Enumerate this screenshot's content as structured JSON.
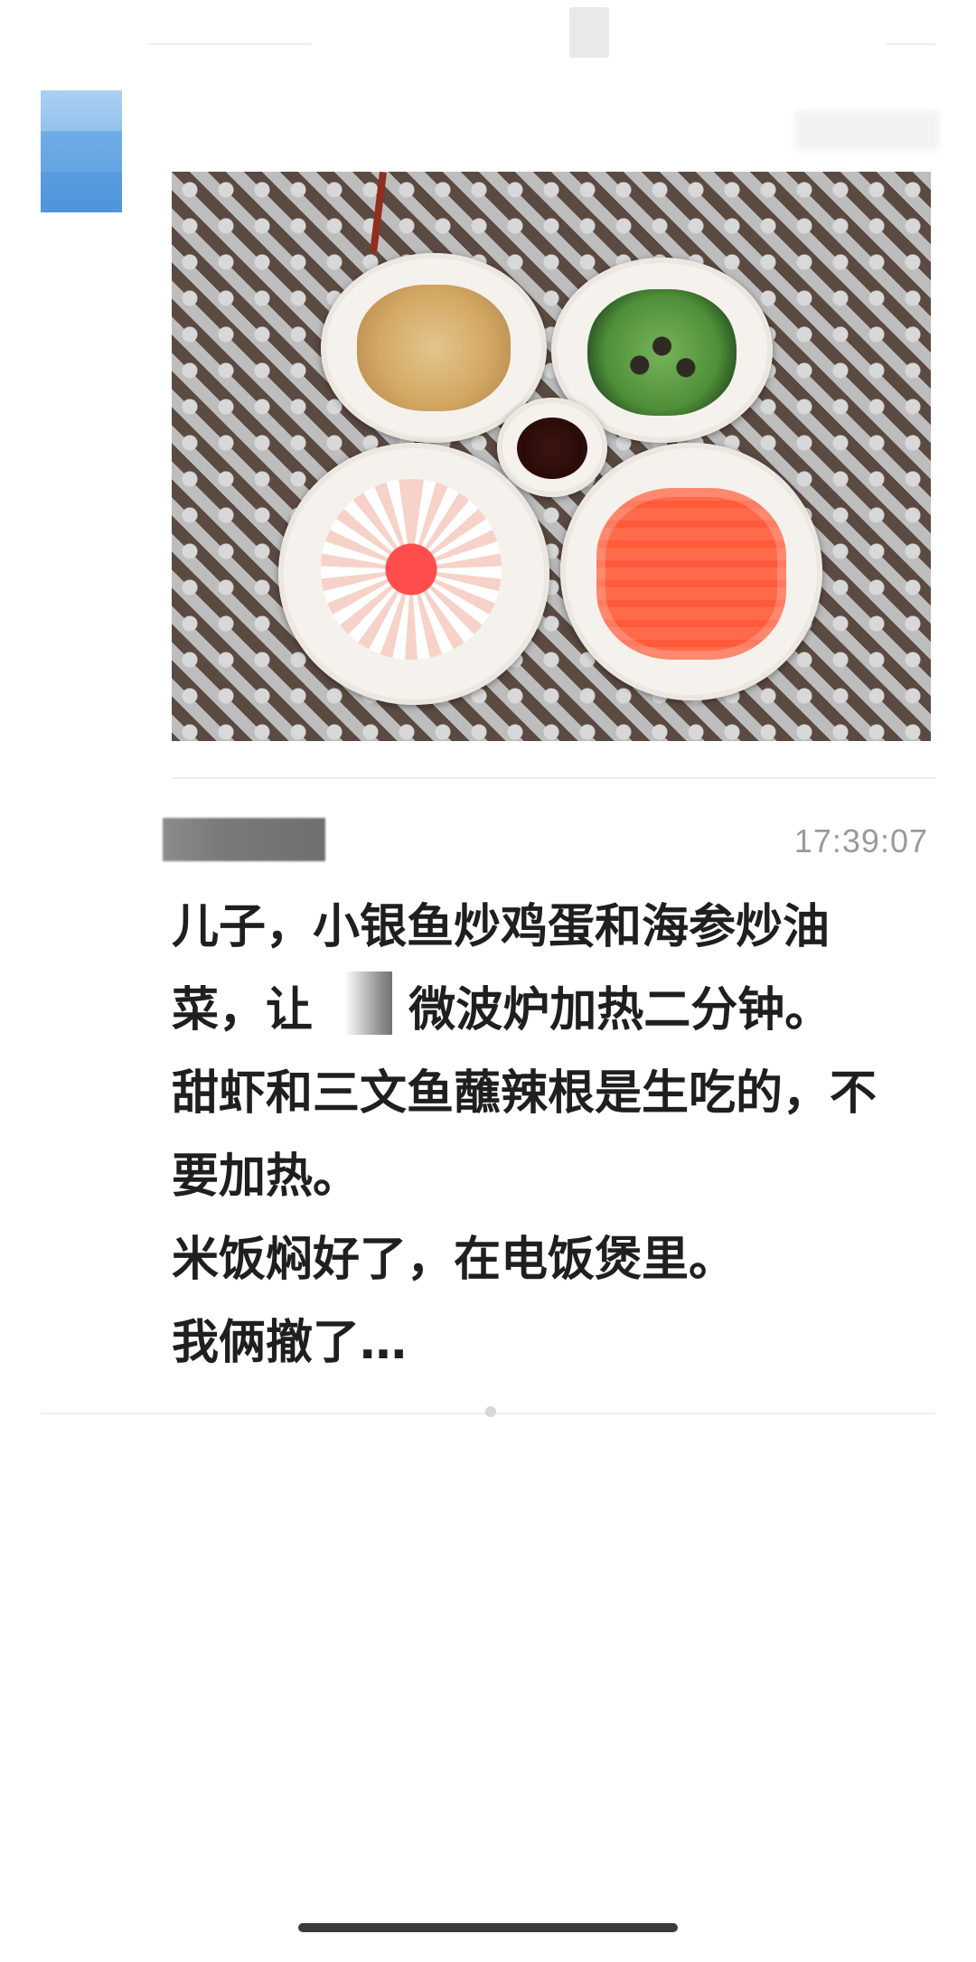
{
  "chat": {
    "timestamp": "17:39:07",
    "message_lines": [
      "儿子，小银鱼炒鸡蛋和海参炒油",
      "菜，让",
      "微波炉加热二分钟。",
      "甜虾和三文鱼蘸辣根是生吃的，不",
      "要加热。",
      "米饭焖好了，在电饭煲里。",
      "我俩撤了…"
    ]
  },
  "icons": {
    "avatar": "avatar-icon",
    "photo": "food-photo-icon"
  },
  "colors": {
    "timestamp": "#9a9a9a",
    "text": "#1f1f1f",
    "divider": "#eeeeee"
  }
}
